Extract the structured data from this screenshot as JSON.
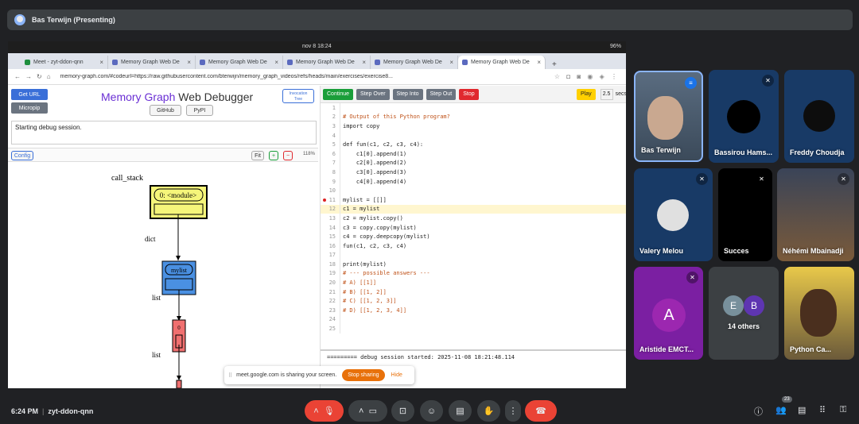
{
  "meet": {
    "presenter_banner": "Bas Terwijn (Presenting)",
    "time": "6:24 PM",
    "meeting_code": "zyt-ddon-qnn",
    "participant_count": "23",
    "share_notice": "meet.google.com is sharing your screen.",
    "stop_sharing": "Stop sharing",
    "hide": "Hide"
  },
  "os": {
    "clock": "nov 8  18:24",
    "battery": "96%"
  },
  "browser": {
    "tabs": [
      {
        "title": "Meet - zyt-ddon-qnn",
        "active": false
      },
      {
        "title": "Memory Graph Web De",
        "active": false
      },
      {
        "title": "Memory Graph Web De",
        "active": false
      },
      {
        "title": "Memory Graph Web De",
        "active": false
      },
      {
        "title": "Memory Graph Web De",
        "active": false
      },
      {
        "title": "Memory Graph Web De",
        "active": true
      }
    ],
    "url": "memory-graph.com/#codeurl=https://raw.githubusercontent.com/bterwijn/memory_graph_videos/refs/heads/main/exercises/exercise8..."
  },
  "app": {
    "title_a": "Memory Graph",
    "title_b": " Web Debugger",
    "get_url": "Get URL",
    "micropip": "Micropip",
    "github": "GitHub",
    "pypi": "PyPI",
    "invocation_tree_1": "Invocation",
    "invocation_tree_2": "Tree",
    "log": "Starting debug session.",
    "config": "Config",
    "fit": "Fit",
    "plus": "+",
    "minus": "−",
    "zoom": "118%"
  },
  "graph": {
    "call_stack_label": "call_stack",
    "module_label": "0: <module>",
    "dict_label": "dict",
    "mylist_label": "mylist",
    "list_label_1": "list",
    "list_label_2": "list",
    "list_index": "0"
  },
  "debugger": {
    "continue": "Continue",
    "step_over": "Step Over",
    "step_into": "Step Into",
    "step_out": "Step Out",
    "stop": "Stop",
    "play": "Play",
    "speed": "2.5",
    "secs": "secs",
    "terminal": "========= debug session started: 2025-11-08 18:21:48.114"
  },
  "code_lines": [
    {
      "n": "1",
      "t": ""
    },
    {
      "n": "2",
      "t": "# Output of this Python program?",
      "c": true
    },
    {
      "n": "3",
      "t": "import copy"
    },
    {
      "n": "4",
      "t": ""
    },
    {
      "n": "5",
      "t": "def fun(c1, c2, c3, c4):"
    },
    {
      "n": "6",
      "t": "    c1[0].append(1)"
    },
    {
      "n": "7",
      "t": "    c2[0].append(2)"
    },
    {
      "n": "8",
      "t": "    c3[0].append(3)"
    },
    {
      "n": "9",
      "t": "    c4[0].append(4)"
    },
    {
      "n": "10",
      "t": ""
    },
    {
      "n": "11",
      "t": "mylist = [[]]",
      "bp": true
    },
    {
      "n": "12",
      "t": "c1 = mylist",
      "hl": true
    },
    {
      "n": "13",
      "t": "c2 = mylist.copy()"
    },
    {
      "n": "14",
      "t": "c3 = copy.copy(mylist)"
    },
    {
      "n": "15",
      "t": "c4 = copy.deepcopy(mylist)"
    },
    {
      "n": "16",
      "t": "fun(c1, c2, c3, c4)"
    },
    {
      "n": "17",
      "t": ""
    },
    {
      "n": "18",
      "t": "print(mylist)"
    },
    {
      "n": "19",
      "t": "# --- possible answers ---",
      "c": true
    },
    {
      "n": "20",
      "t": "# A) [[1]]",
      "c": true
    },
    {
      "n": "21",
      "t": "# B) [[1, 2]]",
      "c": true
    },
    {
      "n": "22",
      "t": "# C) [[1, 2, 3]]",
      "c": true
    },
    {
      "n": "23",
      "t": "# D) [[1, 2, 3, 4]]",
      "c": true
    },
    {
      "n": "24",
      "t": ""
    },
    {
      "n": "25",
      "t": ""
    }
  ],
  "participants": [
    {
      "name": "Bas Terwijn"
    },
    {
      "name": "Bassirou Hams..."
    },
    {
      "name": "Freddy Choudja"
    },
    {
      "name": "Valery Melou"
    },
    {
      "name": "Succes"
    },
    {
      "name": "Néhémi Mbainadji"
    },
    {
      "name": "Aristide EMCT...",
      "initial": "A"
    },
    {
      "name": "14 others",
      "initials": [
        "E",
        "B"
      ]
    },
    {
      "name": "Python Ca..."
    }
  ],
  "colors": {
    "accent_orange": "#e8710a",
    "end_call_red": "#ea4335",
    "aristide_purple": "#7b1fa2"
  }
}
